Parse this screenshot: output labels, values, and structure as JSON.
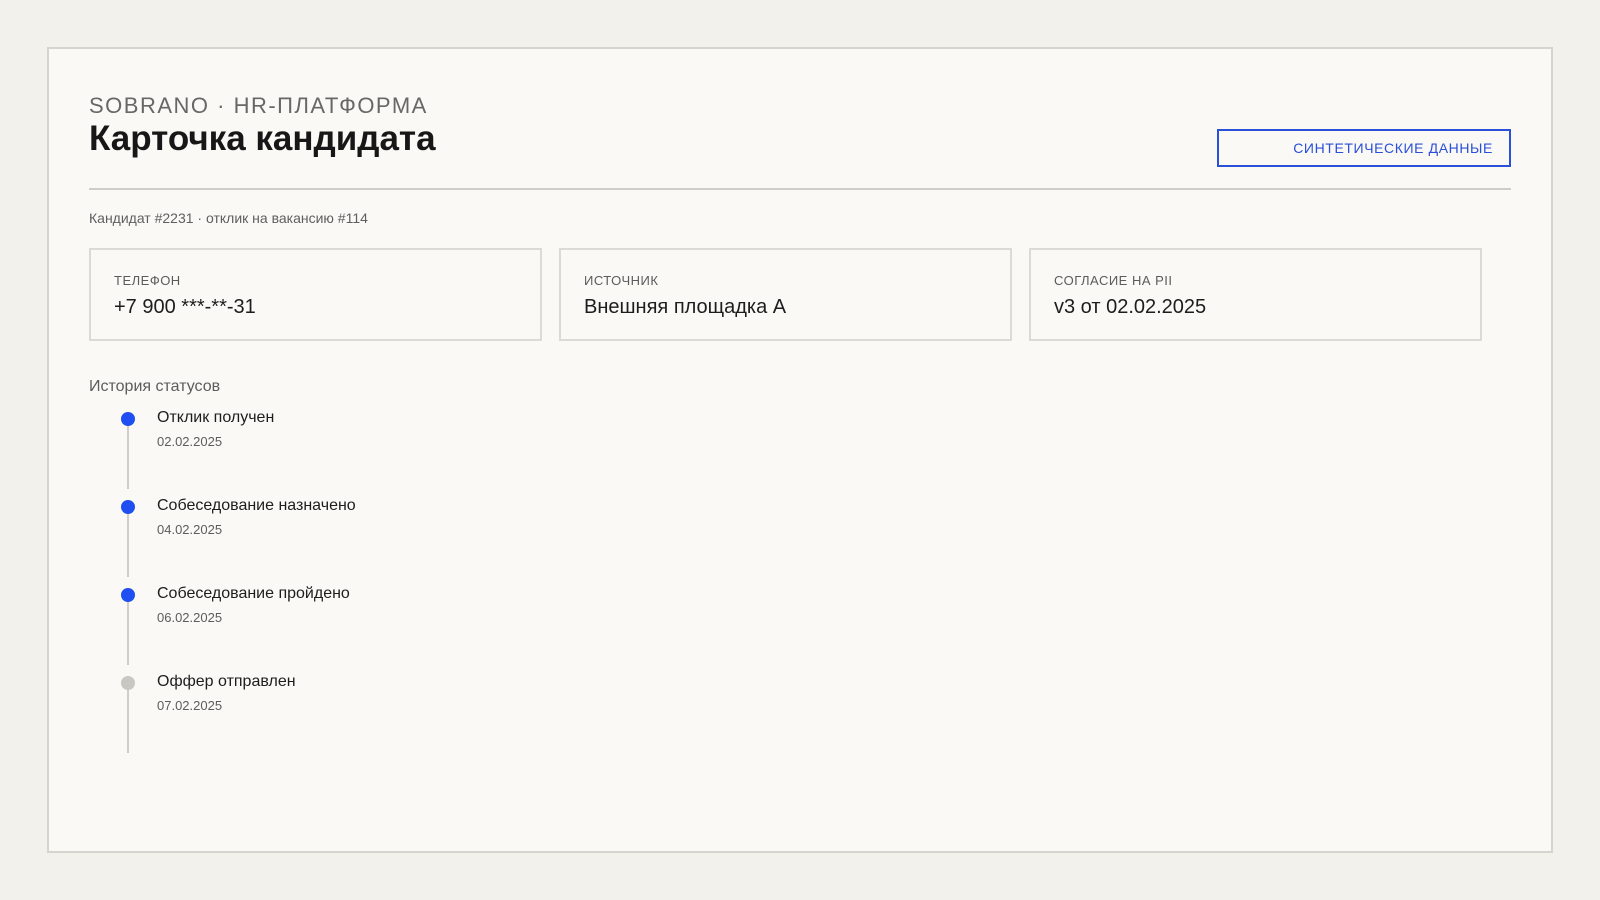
{
  "header": {
    "brand": "SOBRANO · HR-ПЛАТФОРМА",
    "title": "Карточка кандидата",
    "badge": "СИНТЕТИЧЕСКИЕ ДАННЫЕ"
  },
  "candidate": {
    "subtitle": "Кандидат #2231 · отклик на вакансию #114"
  },
  "cards": [
    {
      "label": "ТЕЛЕФОН",
      "value": "+7 900 ***-**-31"
    },
    {
      "label": "ИСТОЧНИК",
      "value": "Внешняя площадка А"
    },
    {
      "label": "СОГЛАСИЕ НА PII",
      "value": "v3 от 02.02.2025"
    }
  ],
  "history": {
    "heading": "История статусов",
    "steps": [
      {
        "title": "Отклик получен",
        "date": "02.02.2025",
        "state": "done"
      },
      {
        "title": "Собеседование назначено",
        "date": "04.02.2025",
        "state": "done"
      },
      {
        "title": "Собеседование пройдено",
        "date": "06.02.2025",
        "state": "done"
      },
      {
        "title": "Оффер отправлен",
        "date": "07.02.2025",
        "state": "pending"
      }
    ]
  },
  "colors": {
    "accent": "#1f4ff0",
    "pending": "#c9c7c2",
    "background": "#f3f1ec",
    "panel": "#faf9f6"
  }
}
